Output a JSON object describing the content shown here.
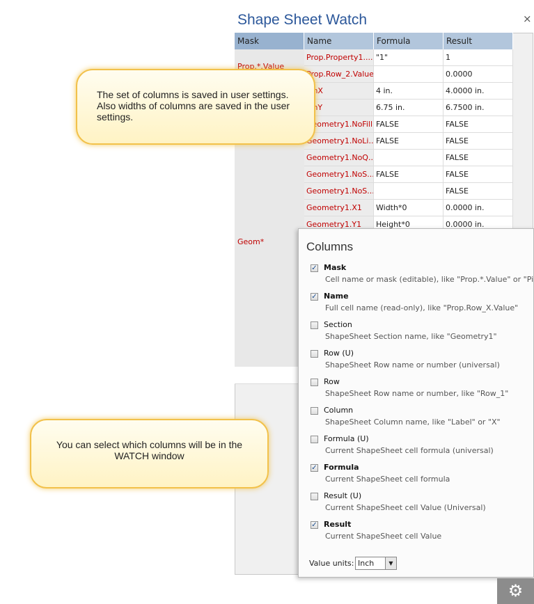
{
  "window": {
    "title": "Shape Sheet Watch",
    "close_label": "×"
  },
  "grid": {
    "columns": [
      "Mask",
      "Name",
      "Formula",
      "Result"
    ],
    "masks": [
      {
        "label": "Prop.*.Value"
      },
      {
        "label": "Geom*"
      }
    ],
    "rows": [
      {
        "name": "Prop.Property1....",
        "formula": "\"1\"",
        "result": "1"
      },
      {
        "name": "Prop.Row_2.Value",
        "formula": "",
        "result": "0.0000"
      },
      {
        "name": "PinX",
        "formula": "4 in.",
        "result": "4.0000 in."
      },
      {
        "name": "PinY",
        "formula": "6.75 in.",
        "result": "6.7500 in."
      },
      {
        "name": "Geometry1.NoFill",
        "formula": "FALSE",
        "result": "FALSE"
      },
      {
        "name": "Geometry1.NoLi...",
        "formula": "FALSE",
        "result": "FALSE"
      },
      {
        "name": "Geometry1.NoQ...",
        "formula": "",
        "result": "FALSE"
      },
      {
        "name": "Geometry1.NoS...",
        "formula": "FALSE",
        "result": "FALSE"
      },
      {
        "name": "Geometry1.NoS...",
        "formula": "",
        "result": "FALSE"
      },
      {
        "name": "Geometry1.X1",
        "formula": "Width*0",
        "result": "0.0000 in."
      },
      {
        "name": "Geometry1.Y1",
        "formula": "Height*0",
        "result": "0.0000 in."
      }
    ]
  },
  "columns_popup": {
    "title": "Columns",
    "options": [
      {
        "label": "Mask",
        "checked": true,
        "bold": true,
        "desc": "Cell name or mask (editable), like \"Prop.*.Value\" or \"PinX\""
      },
      {
        "label": "Name",
        "checked": true,
        "bold": true,
        "desc": "Full cell name (read-only), like \"Prop.Row_X.Value\""
      },
      {
        "label": "Section",
        "checked": false,
        "bold": false,
        "desc": "ShapeSheet Section name, like \"Geometry1\""
      },
      {
        "label": "Row (U)",
        "checked": false,
        "bold": false,
        "desc": "ShapeSheet Row name or number (universal)"
      },
      {
        "label": "Row",
        "checked": false,
        "bold": false,
        "desc": "ShapeSheet Row name or number, like \"Row_1\""
      },
      {
        "label": "Column",
        "checked": false,
        "bold": false,
        "desc": "ShapeSheet Column name, like \"Label\" or \"X\""
      },
      {
        "label": "Formula (U)",
        "checked": false,
        "bold": false,
        "desc": "Current ShapeSheet cell formula (universal)"
      },
      {
        "label": "Formula",
        "checked": true,
        "bold": true,
        "desc": "Current ShapeSheet cell formula"
      },
      {
        "label": "Result (U)",
        "checked": false,
        "bold": false,
        "desc": "Current ShapeSheet cell Value (Universal)"
      },
      {
        "label": "Result",
        "checked": true,
        "bold": true,
        "desc": "Current ShapeSheet cell Value"
      }
    ],
    "units_label": "Value units:",
    "units_value": "Inch"
  },
  "callouts": {
    "first": "The set of columns is saved in user settings. Also widths of columns are saved in the user settings.",
    "second": "You can select which columns will be in the WATCH window"
  },
  "icons": {
    "gear": "gear-icon",
    "checkmark": "check-icon",
    "dropdown": "chevron-down-icon"
  },
  "colors": {
    "title": "#2b579a",
    "cell_name": "#c00000",
    "header": "#b2c6dc",
    "callout_border": "#f2c14a"
  }
}
